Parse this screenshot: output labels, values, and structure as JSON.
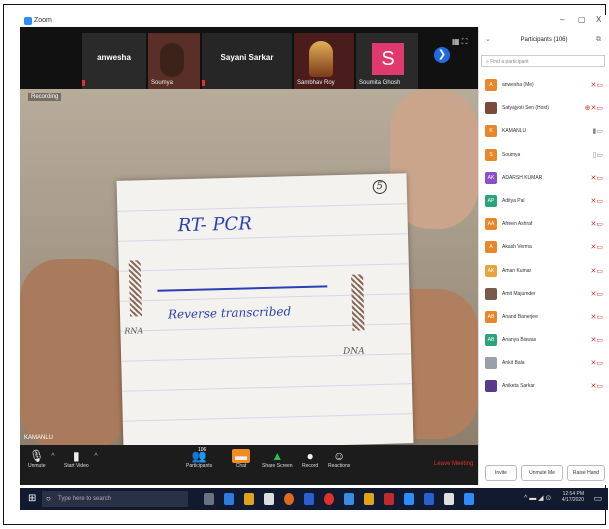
{
  "window": {
    "title": "Zoom",
    "controls": [
      "–",
      "▢",
      "X"
    ]
  },
  "gallery_strip": {
    "tiles": [
      {
        "name": "anwesha",
        "big_name": "anwesha"
      },
      {
        "name": "Soumya"
      },
      {
        "name": "Sayani Sarkar",
        "big_name": "Sayani Sarkar"
      },
      {
        "name": "Sambhav Roy"
      },
      {
        "name": "Soumita Ghosh",
        "avatar_letter": "S"
      }
    ],
    "next_arrow": "❯"
  },
  "main_video": {
    "speaker_badge": "Recording",
    "current_speaker": "KAMANLU",
    "handwriting": {
      "title": "RT- PCR",
      "arrow_label": "Reverse transcribed",
      "right_label": "DNA",
      "left_label": "RNA",
      "circle_number": "5"
    }
  },
  "toolbar": {
    "unmute": "Unmute",
    "start_video": "Start Video",
    "participants": "Participants",
    "participants_count": "106",
    "chat": "Chat",
    "share_screen": "Share Screen",
    "record": "Record",
    "reactions": "Reactions",
    "leave": "Leave Meeting"
  },
  "participants_panel": {
    "title": "Participants (106)",
    "search_placeholder": "Find a participant",
    "participants": [
      {
        "name": "anwesha (Me)",
        "initials": "A",
        "color": "#e8862a"
      },
      {
        "name": "Satyajyoti Sen (Host)",
        "initials": "",
        "color": "#7a4a3a"
      },
      {
        "name": "KAMANLU",
        "initials": "K",
        "color": "#e8862a"
      },
      {
        "name": "Soumya",
        "initials": "S",
        "color": "#e8862a"
      },
      {
        "name": "ADARSH KUMAR",
        "initials": "AK",
        "color": "#8a4fc9"
      },
      {
        "name": "Aditya Pal",
        "initials": "AP",
        "color": "#2aa37a"
      },
      {
        "name": "Afreen Ashraf",
        "initials": "AA",
        "color": "#e8862a"
      },
      {
        "name": "Akash Verma",
        "initials": "A",
        "color": "#e8862a"
      },
      {
        "name": "Aman Kumar",
        "initials": "AK",
        "color": "#e8a33a"
      },
      {
        "name": "Amit Majumder",
        "initials": "",
        "color": "#7a5a4a"
      },
      {
        "name": "Anand Banerjee",
        "initials": "AB",
        "color": "#e8862a"
      },
      {
        "name": "Ananya Biswas",
        "initials": "AB",
        "color": "#2aa37a"
      },
      {
        "name": "Ankit Bala",
        "initials": "",
        "color": "#9aa0aa"
      },
      {
        "name": "Aniketa Sarkar",
        "initials": "",
        "color": "#5a3a8a"
      }
    ],
    "footer": {
      "invite": "Invite",
      "unmute_me": "Unmute Me",
      "raise_hand": "Raise Hand"
    }
  },
  "taskbar": {
    "search_placeholder": "Type here to search",
    "time": "12:54 PM",
    "date": "4/17/2020"
  }
}
